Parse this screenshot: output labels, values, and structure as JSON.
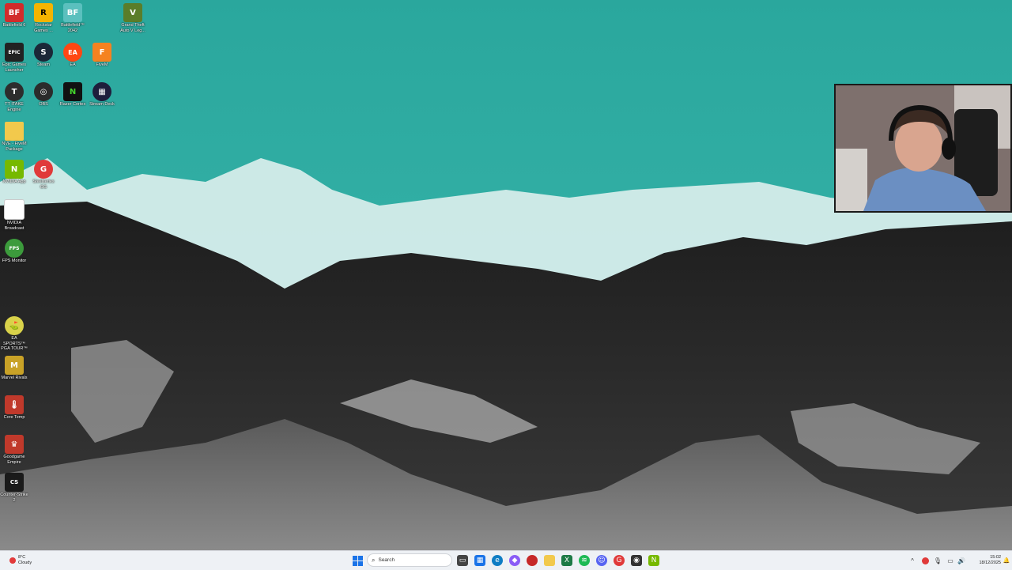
{
  "desktop": {
    "icons": [
      {
        "label": "Battlefield 6",
        "glyph": "BF",
        "color": "#d22b2b"
      },
      {
        "label": "Rockstar Games ...",
        "glyph": "R",
        "color": "#f4b400"
      },
      {
        "label": "Battlefield™ 2042",
        "glyph": "BF",
        "color": "#5bc0be"
      },
      {
        "label": "Grand Theft Auto V Leg...",
        "glyph": "V",
        "color": "#5a7d2a"
      },
      {
        "label": "Epic Games Launcher",
        "glyph": "EPIC",
        "color": "#222222"
      },
      {
        "label": "Steam",
        "glyph": "S",
        "color": "#1b2838"
      },
      {
        "label": "EA",
        "glyph": "EA",
        "color": "#ff4713"
      },
      {
        "label": "FiveM",
        "glyph": "F",
        "color": "#f58220"
      },
      {
        "label": "TT ITAKE Engine",
        "glyph": "T",
        "color": "#2d2d2d"
      },
      {
        "label": "OBS",
        "glyph": "◎",
        "color": "#2b2b2b"
      },
      {
        "label": "Razer Cortex",
        "glyph": "N",
        "color": "#111111"
      },
      {
        "label": "Stream Deck",
        "glyph": "▦",
        "color": "#1e1e3c"
      },
      {
        "label": "NVE - FiveM Package",
        "glyph": "",
        "color": "#f2c94c"
      },
      {
        "label": "NVIDIA App",
        "glyph": "N",
        "color": "#76b900"
      },
      {
        "label": "Steelseries GG",
        "glyph": "G",
        "color": "#e03a3a"
      },
      {
        "label": "NVIDIA Broadcast",
        "glyph": "",
        "color": "#ffffff"
      },
      {
        "label": "FPS Monitor",
        "glyph": "FPS",
        "color": "#3c9b3c"
      },
      {
        "label": "EA SPORTS™ PGA TOUR™",
        "glyph": "⛳",
        "color": "#d9d24a"
      },
      {
        "label": "Marvel Rivals",
        "glyph": "M",
        "color": "#c9a227"
      },
      {
        "label": "Core Temp",
        "glyph": "🌡",
        "color": "#c0392b"
      },
      {
        "label": "Goodgame Empire",
        "glyph": "♛",
        "color": "#c0392b"
      },
      {
        "label": "Counter-Strike 2",
        "glyph": "CS",
        "color": "#1a1a1a"
      }
    ]
  },
  "taskbar": {
    "weather": {
      "temp": "8°C",
      "condition": "Cloudy"
    },
    "search_placeholder": "Search",
    "time": "15:02",
    "date": "18/12/2025"
  }
}
